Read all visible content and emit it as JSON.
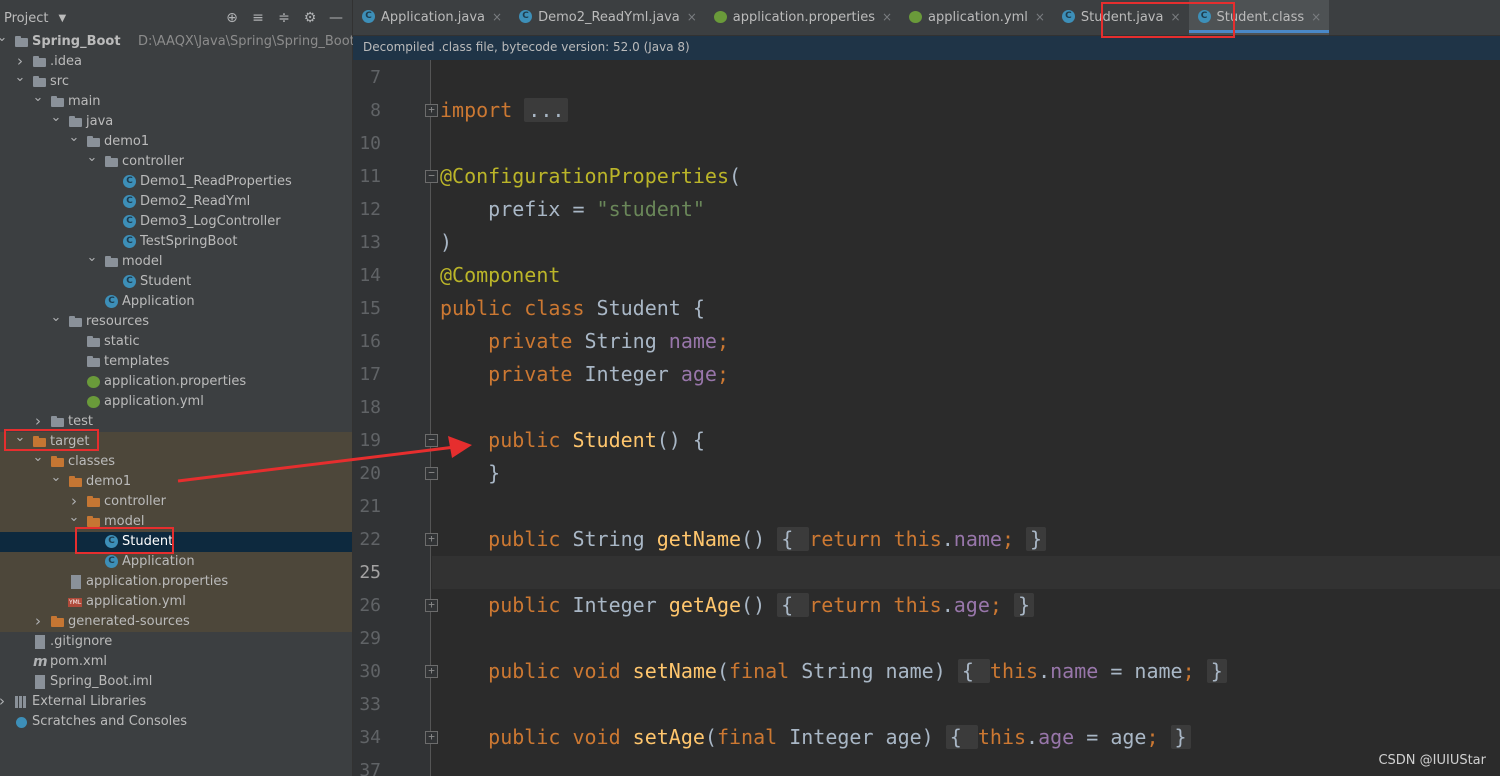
{
  "project_panel": {
    "title": "Project",
    "tools": [
      "locate-icon",
      "expand-all-icon",
      "collapse-all-icon",
      "gear-icon",
      "hide-icon"
    ],
    "tree": [
      {
        "label": "Spring_Boot",
        "path": "D:\\AAQX\\Java\\Spring\\Spring_Boot",
        "depth": 0,
        "arrow": "v",
        "icon": "folder",
        "bold": true
      },
      {
        "label": ".idea",
        "depth": 1,
        "arrow": ">",
        "icon": "folder"
      },
      {
        "label": "src",
        "depth": 1,
        "arrow": "v",
        "icon": "folder"
      },
      {
        "label": "main",
        "depth": 2,
        "arrow": "v",
        "icon": "folder"
      },
      {
        "label": "java",
        "depth": 3,
        "arrow": "v",
        "icon": "folder"
      },
      {
        "label": "demo1",
        "depth": 4,
        "arrow": "v",
        "icon": "package"
      },
      {
        "label": "controller",
        "depth": 5,
        "arrow": "v",
        "icon": "package"
      },
      {
        "label": "Demo1_ReadProperties",
        "depth": 6,
        "icon": "class"
      },
      {
        "label": "Demo2_ReadYml",
        "depth": 6,
        "icon": "class"
      },
      {
        "label": "Demo3_LogController",
        "depth": 6,
        "icon": "class"
      },
      {
        "label": "TestSpringBoot",
        "depth": 6,
        "icon": "class"
      },
      {
        "label": "model",
        "depth": 5,
        "arrow": "v",
        "icon": "package"
      },
      {
        "label": "Student",
        "depth": 6,
        "icon": "class"
      },
      {
        "label": "Application",
        "depth": 5,
        "icon": "class"
      },
      {
        "label": "resources",
        "depth": 3,
        "arrow": "v",
        "icon": "folder"
      },
      {
        "label": "static",
        "depth": 4,
        "icon": "folder"
      },
      {
        "label": "templates",
        "depth": 4,
        "icon": "folder"
      },
      {
        "label": "application.properties",
        "depth": 4,
        "icon": "spring"
      },
      {
        "label": "application.yml",
        "depth": 4,
        "icon": "spring"
      },
      {
        "label": "test",
        "depth": 2,
        "arrow": ">",
        "icon": "folder"
      },
      {
        "label": "target",
        "depth": 1,
        "arrow": "v",
        "icon": "folder-orange",
        "excluded": true
      },
      {
        "label": "classes",
        "depth": 2,
        "arrow": "v",
        "icon": "folder-orange",
        "excluded": true
      },
      {
        "label": "demo1",
        "depth": 3,
        "arrow": "v",
        "icon": "folder-orange",
        "excluded": true
      },
      {
        "label": "controller",
        "depth": 4,
        "arrow": ">",
        "icon": "folder-orange",
        "excluded": true
      },
      {
        "label": "model",
        "depth": 4,
        "arrow": "v",
        "icon": "folder-orange",
        "excluded": true
      },
      {
        "label": "Student",
        "depth": 5,
        "icon": "class",
        "selected": true
      },
      {
        "label": "Application",
        "depth": 5,
        "icon": "class",
        "excluded": true
      },
      {
        "label": "application.properties",
        "depth": 3,
        "icon": "file",
        "excluded": true
      },
      {
        "label": "application.yml",
        "depth": 3,
        "icon": "yml",
        "excluded": true
      },
      {
        "label": "generated-sources",
        "depth": 2,
        "arrow": ">",
        "icon": "folder-orange",
        "excluded": true
      },
      {
        "label": ".gitignore",
        "depth": 1,
        "icon": "file"
      },
      {
        "label": "pom.xml",
        "depth": 1,
        "icon": "maven"
      },
      {
        "label": "Spring_Boot.iml",
        "depth": 1,
        "icon": "file"
      },
      {
        "label": "External Libraries",
        "depth": 0,
        "arrow": ">",
        "icon": "lib"
      },
      {
        "label": "Scratches and Consoles",
        "depth": 0,
        "icon": "scratch"
      }
    ]
  },
  "tabs": [
    {
      "label": "Application.java",
      "icon": "class"
    },
    {
      "label": "Demo2_ReadYml.java",
      "icon": "class"
    },
    {
      "label": "application.properties",
      "icon": "spring"
    },
    {
      "label": "application.yml",
      "icon": "spring"
    },
    {
      "label": "Student.java",
      "icon": "class"
    },
    {
      "label": "Student.class",
      "icon": "class",
      "active": true
    }
  ],
  "banner": "Decompiled .class file, bytecode version: 52.0 (Java 8)",
  "editor": {
    "current_line": "25",
    "lines": [
      {
        "n": "7",
        "tokens": []
      },
      {
        "n": "8",
        "fold": "+",
        "tokens": [
          [
            "kw",
            "import"
          ],
          [
            "t",
            " "
          ],
          [
            "fold-region",
            "..."
          ]
        ]
      },
      {
        "n": "10",
        "tokens": []
      },
      {
        "n": "11",
        "fold": "-",
        "tokens": [
          [
            "ann",
            "@ConfigurationProperties"
          ],
          [
            "t",
            "("
          ]
        ]
      },
      {
        "n": "12",
        "tokens": [
          [
            "t",
            "    prefix = "
          ],
          [
            "str",
            "\"student\""
          ]
        ]
      },
      {
        "n": "13",
        "tokens": [
          [
            "t",
            ")"
          ]
        ]
      },
      {
        "n": "14",
        "tokens": [
          [
            "ann",
            "@Component"
          ]
        ]
      },
      {
        "n": "15",
        "tokens": [
          [
            "kw",
            "public class "
          ],
          [
            "t",
            "Student {"
          ]
        ]
      },
      {
        "n": "16",
        "tokens": [
          [
            "t",
            "    "
          ],
          [
            "kw",
            "private "
          ],
          [
            "t",
            "String "
          ],
          [
            "fld",
            "name"
          ],
          [
            "kw",
            ";"
          ]
        ]
      },
      {
        "n": "17",
        "tokens": [
          [
            "t",
            "    "
          ],
          [
            "kw",
            "private "
          ],
          [
            "t",
            "Integer "
          ],
          [
            "fld",
            "age"
          ],
          [
            "kw",
            ";"
          ]
        ]
      },
      {
        "n": "18",
        "tokens": []
      },
      {
        "n": "19",
        "fold": "-",
        "tokens": [
          [
            "t",
            "    "
          ],
          [
            "kw",
            "public "
          ],
          [
            "fn",
            "Student"
          ],
          [
            "t",
            "() {"
          ]
        ]
      },
      {
        "n": "20",
        "fold": "-",
        "tokens": [
          [
            "t",
            "    }"
          ]
        ]
      },
      {
        "n": "21",
        "tokens": []
      },
      {
        "n": "22",
        "fold": "+",
        "tokens": [
          [
            "t",
            "    "
          ],
          [
            "kw",
            "public "
          ],
          [
            "t",
            "String "
          ],
          [
            "fn",
            "getName"
          ],
          [
            "t",
            "() "
          ],
          [
            "fold-region",
            "{ "
          ],
          [
            "kw",
            "return this"
          ],
          [
            "t",
            "."
          ],
          [
            "fld",
            "name"
          ],
          [
            "kw",
            "; "
          ],
          [
            "fold-region",
            "}"
          ]
        ]
      },
      {
        "n": "25",
        "tokens": []
      },
      {
        "n": "26",
        "fold": "+",
        "tokens": [
          [
            "t",
            "    "
          ],
          [
            "kw",
            "public "
          ],
          [
            "t",
            "Integer "
          ],
          [
            "fn",
            "getAge"
          ],
          [
            "t",
            "() "
          ],
          [
            "fold-region",
            "{ "
          ],
          [
            "kw",
            "return this"
          ],
          [
            "t",
            "."
          ],
          [
            "fld",
            "age"
          ],
          [
            "kw",
            "; "
          ],
          [
            "fold-region",
            "}"
          ]
        ]
      },
      {
        "n": "29",
        "tokens": []
      },
      {
        "n": "30",
        "fold": "+",
        "tokens": [
          [
            "t",
            "    "
          ],
          [
            "kw",
            "public void "
          ],
          [
            "fn",
            "setName"
          ],
          [
            "t",
            "("
          ],
          [
            "kw",
            "final "
          ],
          [
            "t",
            "String name) "
          ],
          [
            "fold-region",
            "{ "
          ],
          [
            "kw",
            "this"
          ],
          [
            "t",
            "."
          ],
          [
            "fld",
            "name"
          ],
          [
            "t",
            " = name"
          ],
          [
            "kw",
            "; "
          ],
          [
            "fold-region",
            "}"
          ]
        ]
      },
      {
        "n": "33",
        "tokens": []
      },
      {
        "n": "34",
        "fold": "+",
        "tokens": [
          [
            "t",
            "    "
          ],
          [
            "kw",
            "public void "
          ],
          [
            "fn",
            "setAge"
          ],
          [
            "t",
            "("
          ],
          [
            "kw",
            "final "
          ],
          [
            "t",
            "Integer age) "
          ],
          [
            "fold-region",
            "{ "
          ],
          [
            "kw",
            "this"
          ],
          [
            "t",
            "."
          ],
          [
            "fld",
            "age"
          ],
          [
            "t",
            " = age"
          ],
          [
            "kw",
            "; "
          ],
          [
            "fold-region",
            "}"
          ]
        ]
      },
      {
        "n": "37",
        "tokens": []
      }
    ]
  },
  "watermark": "CSDN @IUIUStar",
  "colors": {
    "annotation_red": "#e62e2e",
    "keyword": "#cc7832",
    "annotation": "#bbb529",
    "string": "#6a8759",
    "field": "#9876aa",
    "method": "#ffc66d"
  }
}
